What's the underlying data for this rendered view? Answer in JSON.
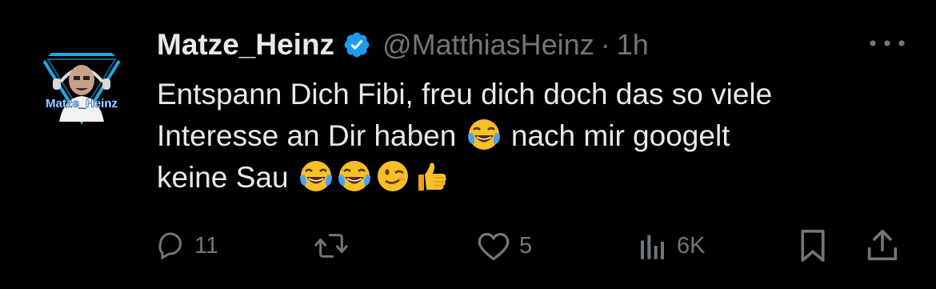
{
  "tweet": {
    "display_name": "Matze_Heinz",
    "handle": "@MatthiasHeinz",
    "separator": "·",
    "time": "1h",
    "avatar_text": "Matze_Heinz",
    "text_line1": "Entspann Dich Fibi, freu dich doch das so viele",
    "text_line2a": "Interesse an Dir haben",
    "text_line2b": "nach mir googelt",
    "text_line3": "keine Sau",
    "emojis": [
      "face-with-tears-of-joy",
      "face-with-tears-of-joy",
      "face-with-tears-of-joy",
      "winking-face",
      "thumbs-up"
    ]
  },
  "actions": {
    "reply_count": "11",
    "repost_count": "",
    "like_count": "5",
    "views_count": "6K"
  },
  "colors": {
    "background": "#000000",
    "text": "#e7e9ea",
    "muted": "#71767b",
    "verified": "#1d9bf0"
  }
}
